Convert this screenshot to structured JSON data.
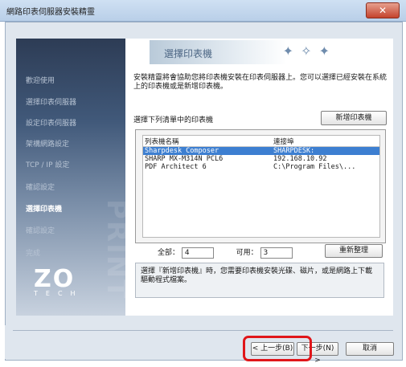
{
  "window": {
    "title": "網路印表伺服器安裝精靈",
    "close_glyph": "✕"
  },
  "sidebar": {
    "items": [
      {
        "label": "歡迎使用",
        "active": false
      },
      {
        "label": "選擇印表伺服器",
        "active": false
      },
      {
        "label": "設定印表伺服器",
        "active": false
      },
      {
        "label": "架構網路設定",
        "active": false
      },
      {
        "label": "TCP / IP 設定",
        "active": false
      },
      {
        "label": "確認設定",
        "active": false
      },
      {
        "label": "選擇印表機",
        "active": true
      },
      {
        "label": "確認設定",
        "active": false
      },
      {
        "label": "完成",
        "active": false
      }
    ],
    "watermark": "PRINT",
    "logo": {
      "mark": "ZO",
      "text": "TECH"
    }
  },
  "main": {
    "banner_title": "選擇印表機",
    "description": "安裝精靈將會協助您將印表機安裝在印表伺服器上。您可以選擇已經安裝在系統上的印表機或是新增印表機。",
    "select_label": "選擇下列清單中的印表機",
    "add_printer_button": "新增印表機",
    "list": {
      "columns": [
        "列表機名稱",
        "連接埠"
      ],
      "rows": [
        {
          "name": "Sharpdesk Composer",
          "port": "SHARPDESK:",
          "selected": true
        },
        {
          "name": "SHARP MX-M314N PCL6",
          "port": "192.168.10.92",
          "selected": false
        },
        {
          "name": "PDF Architect 6",
          "port": "C:\\Program Files\\...",
          "selected": false
        }
      ]
    },
    "counts": {
      "total_label": "全部：",
      "total": "4",
      "available_label": "可用：",
      "available": "3"
    },
    "refresh_button": "重新整理",
    "note": "選擇『新增印表機』時，您需要印表機安裝光碟、磁片，或是網路上下載驅動程式檔案。"
  },
  "footer": {
    "back": "< 上一步(B)",
    "next": "下一步(N) >",
    "cancel": "取消"
  },
  "colors": {
    "highlight": "#e0161a",
    "selection": "#3d7fd1"
  }
}
